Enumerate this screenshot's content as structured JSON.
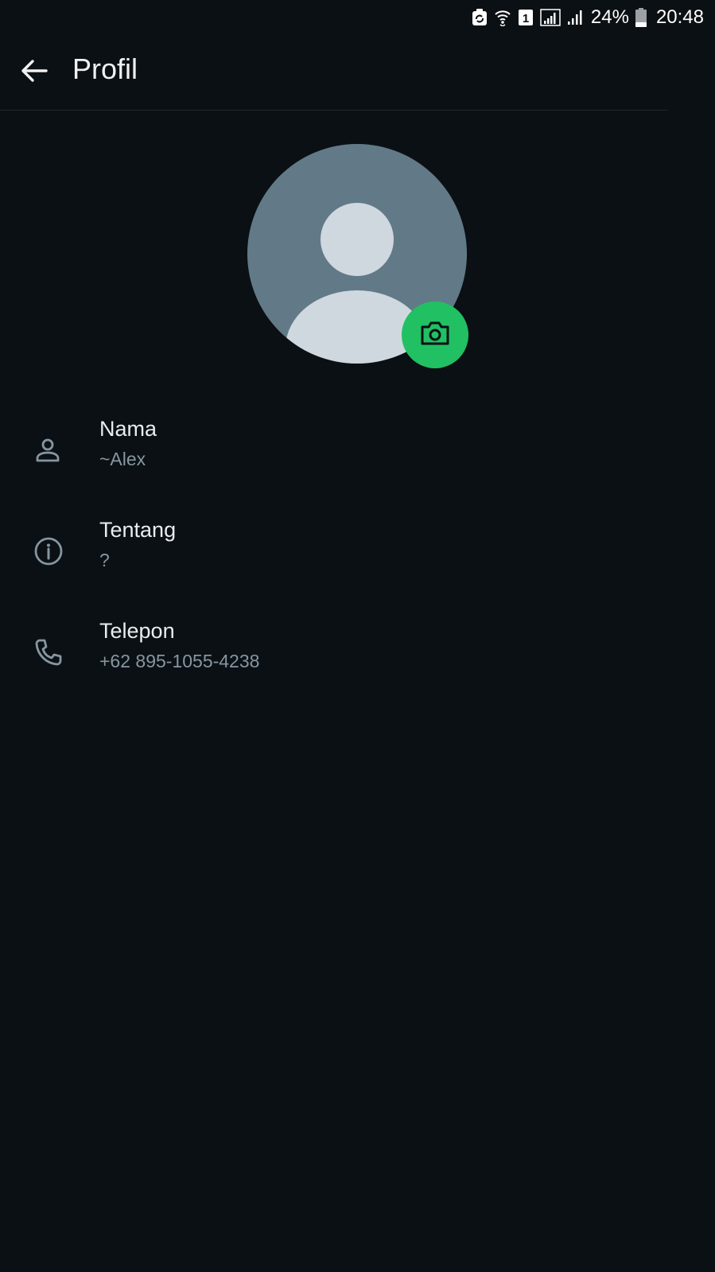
{
  "status_bar": {
    "battery_percent": "24%",
    "time": "20:48",
    "sim_label": "1",
    "icons": [
      "sync-icon",
      "wifi-icon",
      "sim-icon",
      "signal-icon",
      "signal-icon",
      "battery-icon"
    ]
  },
  "header": {
    "title": "Profil",
    "back_icon": "arrow-left-icon"
  },
  "avatar": {
    "icon": "default-person-avatar",
    "camera_icon": "camera-icon",
    "camera_color": "#21c063"
  },
  "fields": [
    {
      "icon": "person-icon",
      "label": "Nama",
      "value": "~Alex"
    },
    {
      "icon": "info-icon",
      "label": "Tentang",
      "value": "?"
    },
    {
      "icon": "phone-icon",
      "label": "Telepon",
      "value": "+62 895-1055-4238"
    }
  ],
  "colors": {
    "background": "#0b1014",
    "accent": "#21c063",
    "secondary_text": "#8696a0"
  }
}
